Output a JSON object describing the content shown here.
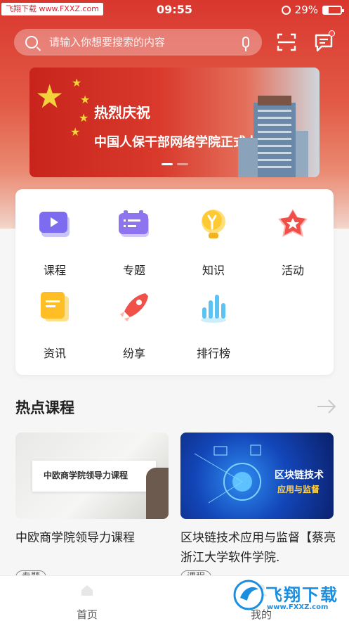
{
  "status_bar": {
    "site_tag": "飞翔下载 www.FXXZ.com",
    "time": "09:55",
    "battery_percent": "29%",
    "battery_level": 0.29
  },
  "search": {
    "placeholder": "请输入你想要搜索的内容"
  },
  "banner": {
    "line1": "热烈庆祝",
    "line2": "中国人保干部网络学院正式上线"
  },
  "quick_menu": [
    {
      "label": "课程",
      "icon": "video-play-icon"
    },
    {
      "label": "专题",
      "icon": "folder-list-icon"
    },
    {
      "label": "知识",
      "icon": "lightbulb-icon"
    },
    {
      "label": "活动",
      "icon": "star-badge-icon"
    },
    {
      "label": "资讯",
      "icon": "news-document-icon"
    },
    {
      "label": "纷享",
      "icon": "rocket-icon"
    },
    {
      "label": "排行榜",
      "icon": "bar-ranking-icon"
    }
  ],
  "hot_courses": {
    "title": "热点课程",
    "items": [
      {
        "thumb_text": "中欧商学院领导力课程",
        "title": "中欧商学院领导力课程",
        "tag": "专题"
      },
      {
        "thumb_text_main": "区块链技术",
        "thumb_text_sub": "应用与监督",
        "title": "区块链技术应用与监督【蔡亮 浙江大学软件学院.",
        "tag": "课程"
      }
    ]
  },
  "bottom_nav": [
    {
      "label": "首页"
    },
    {
      "label": "我的"
    }
  ],
  "watermark": {
    "text": "飞翔下载",
    "url": "www.FXXZ.com"
  },
  "colors": {
    "brand_red": "#d9372e",
    "search_bg": "rgba(255,255,255,0.32)",
    "badge_red": "#ff4a4a",
    "watermark_blue": "#1a8fe0"
  }
}
